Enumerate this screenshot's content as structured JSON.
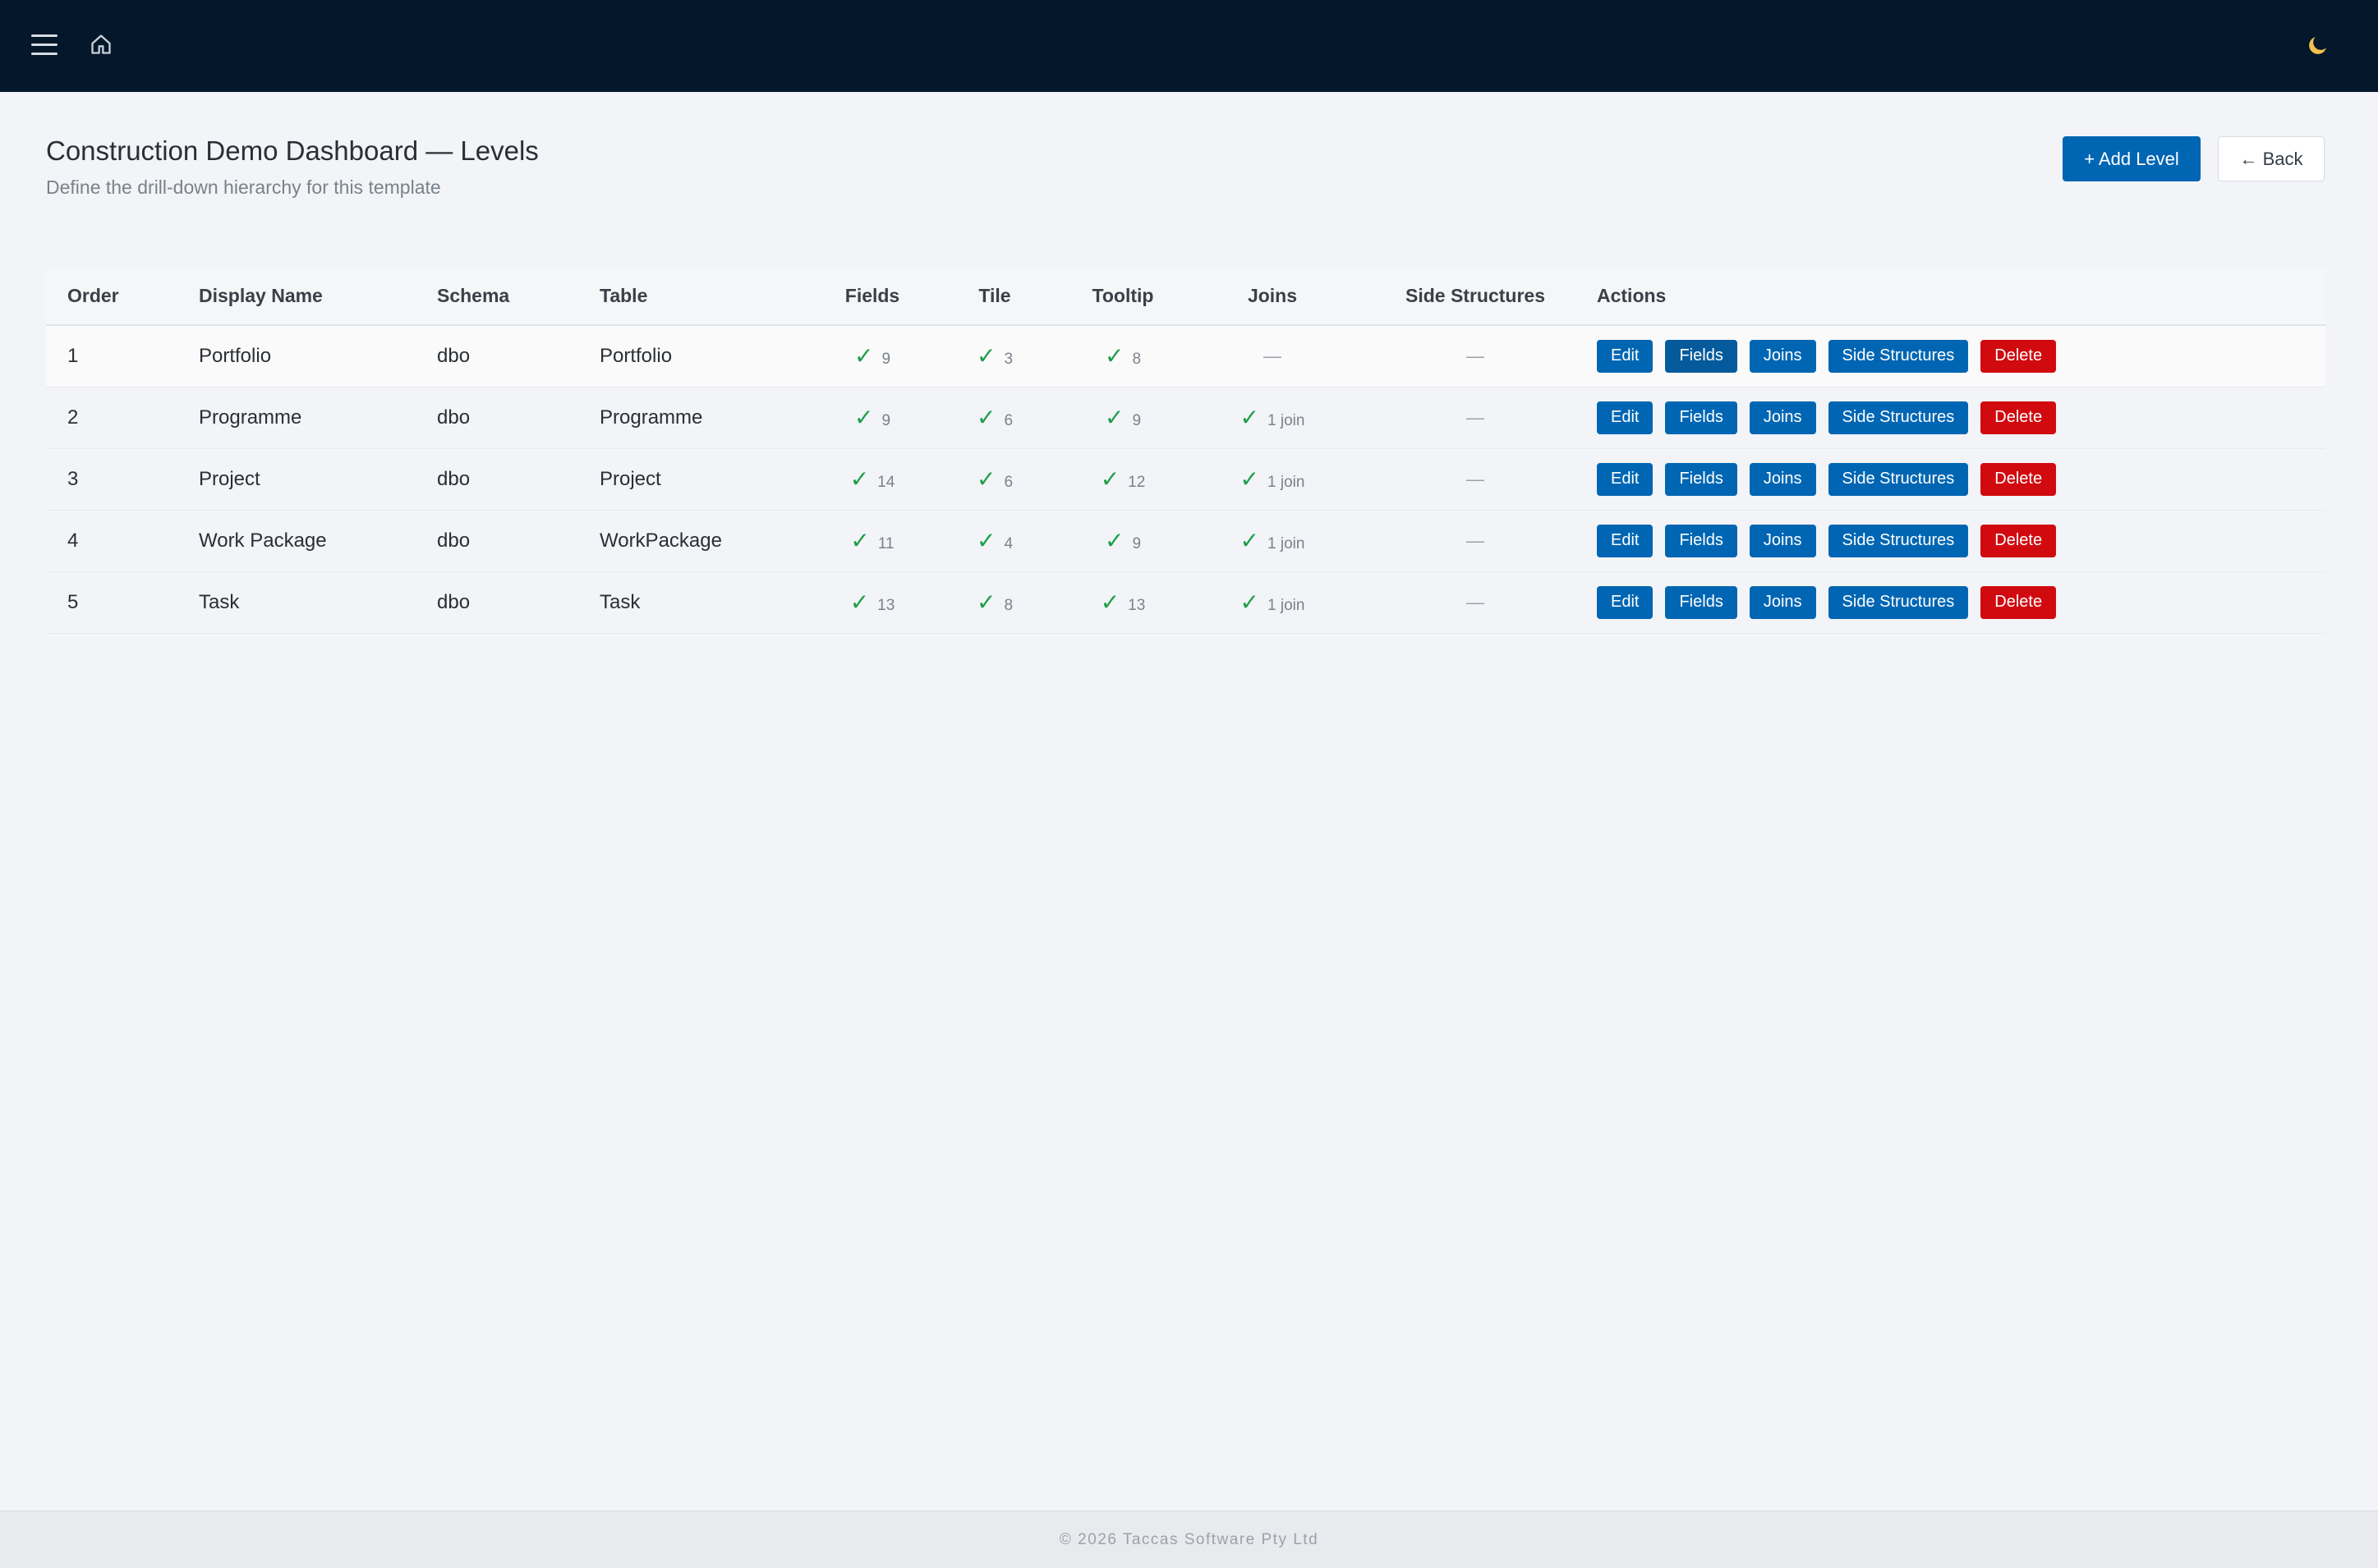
{
  "page": {
    "title": "Construction Demo Dashboard — Levels",
    "subtitle": "Define the drill-down hierarchy for this template"
  },
  "toolbar": {
    "add_label": "+ Add Level",
    "back_label": "← Back"
  },
  "table": {
    "headers": [
      "Order",
      "Display Name",
      "Schema",
      "Table",
      "Fields",
      "Tile",
      "Tooltip",
      "Joins",
      "Side Structures",
      "Actions"
    ],
    "rows": [
      {
        "order": "1",
        "display_name": "Portfolio",
        "schema": "dbo",
        "table": "Portfolio",
        "fields": "9",
        "tile": "3",
        "tooltip": "8",
        "joins": "—",
        "side": "—"
      },
      {
        "order": "2",
        "display_name": "Programme",
        "schema": "dbo",
        "table": "Programme",
        "fields": "9",
        "tile": "6",
        "tooltip": "9",
        "joins": "1 join",
        "side": "—"
      },
      {
        "order": "3",
        "display_name": "Project",
        "schema": "dbo",
        "table": "Project",
        "fields": "14",
        "tile": "6",
        "tooltip": "12",
        "joins": "1 join",
        "side": "—"
      },
      {
        "order": "4",
        "display_name": "Work Package",
        "schema": "dbo",
        "table": "WorkPackage",
        "fields": "11",
        "tile": "4",
        "tooltip": "9",
        "joins": "1 join",
        "side": "—"
      },
      {
        "order": "5",
        "display_name": "Task",
        "schema": "dbo",
        "table": "Task",
        "fields": "13",
        "tile": "8",
        "tooltip": "13",
        "joins": "1 join",
        "side": "—"
      }
    ],
    "check_glyph": "✓",
    "action_labels": {
      "edit": "Edit",
      "fields": "Fields",
      "joins": "Joins",
      "side": "Side Structures",
      "delete": "Delete"
    }
  },
  "footer": {
    "text": "© 2026 Taccas Software Pty Ltd"
  },
  "icons": {
    "menu": "menu-icon",
    "home": "home-icon",
    "theme": "moon-icon"
  },
  "colors": {
    "topbar": "#04172b",
    "primary": "#0066b3",
    "danger": "#d10a10",
    "check": "#1e9e4a"
  }
}
